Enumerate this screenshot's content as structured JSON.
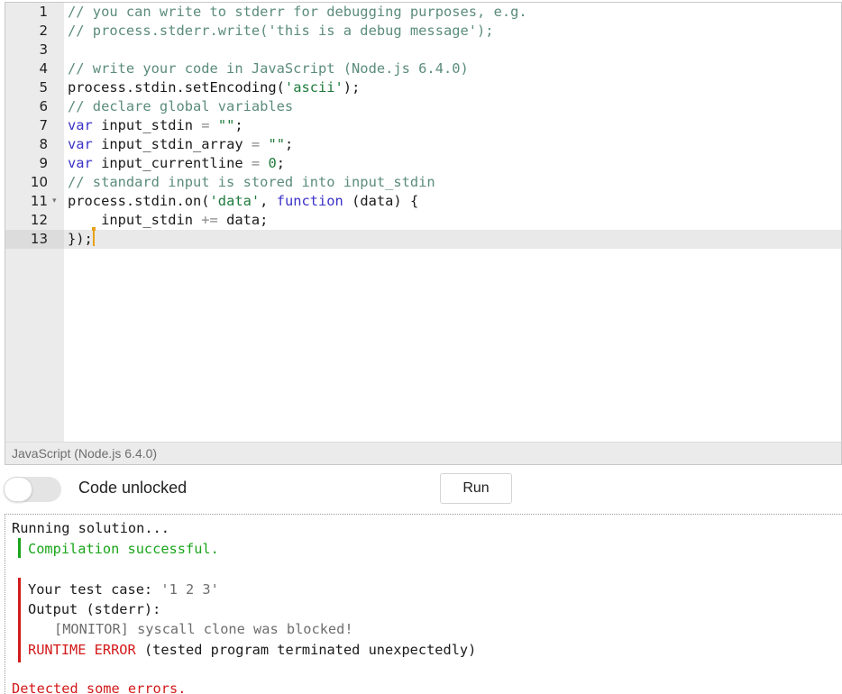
{
  "editor": {
    "language_label": "JavaScript (Node.js 6.4.0)",
    "active_line": 13,
    "lines": [
      {
        "num": "1",
        "fold": "",
        "tokens": [
          {
            "t": "// you can write to stderr for debugging purposes, e.g.",
            "c": "comment"
          }
        ]
      },
      {
        "num": "2",
        "fold": "",
        "tokens": [
          {
            "t": "// process.stderr.write('this is a debug message');",
            "c": "comment"
          }
        ]
      },
      {
        "num": "3",
        "fold": "",
        "tokens": []
      },
      {
        "num": "4",
        "fold": "",
        "tokens": [
          {
            "t": "// write your code in JavaScript (Node.js 6.4.0)",
            "c": "comment"
          }
        ]
      },
      {
        "num": "5",
        "fold": "",
        "tokens": [
          {
            "t": "process.stdin.setEncoding(",
            "c": "plain"
          },
          {
            "t": "'ascii'",
            "c": "string"
          },
          {
            "t": ");",
            "c": "plain"
          }
        ]
      },
      {
        "num": "6",
        "fold": "",
        "tokens": [
          {
            "t": "// declare global variables",
            "c": "comment"
          }
        ]
      },
      {
        "num": "7",
        "fold": "",
        "tokens": [
          {
            "t": "var",
            "c": "keyword"
          },
          {
            "t": " input_stdin ",
            "c": "plain"
          },
          {
            "t": "=",
            "c": "op"
          },
          {
            "t": " ",
            "c": "plain"
          },
          {
            "t": "\"\"",
            "c": "string"
          },
          {
            "t": ";",
            "c": "plain"
          }
        ]
      },
      {
        "num": "8",
        "fold": "",
        "tokens": [
          {
            "t": "var",
            "c": "keyword"
          },
          {
            "t": " input_stdin_array ",
            "c": "plain"
          },
          {
            "t": "=",
            "c": "op"
          },
          {
            "t": " ",
            "c": "plain"
          },
          {
            "t": "\"\"",
            "c": "string"
          },
          {
            "t": ";",
            "c": "plain"
          }
        ]
      },
      {
        "num": "9",
        "fold": "",
        "tokens": [
          {
            "t": "var",
            "c": "keyword"
          },
          {
            "t": " input_currentline ",
            "c": "plain"
          },
          {
            "t": "=",
            "c": "op"
          },
          {
            "t": " ",
            "c": "plain"
          },
          {
            "t": "0",
            "c": "number"
          },
          {
            "t": ";",
            "c": "plain"
          }
        ]
      },
      {
        "num": "10",
        "fold": "",
        "tokens": [
          {
            "t": "// standard input is stored into input_stdin",
            "c": "comment"
          }
        ]
      },
      {
        "num": "11",
        "fold": "▾",
        "tokens": [
          {
            "t": "process.stdin.on(",
            "c": "plain"
          },
          {
            "t": "'data'",
            "c": "string"
          },
          {
            "t": ", ",
            "c": "plain"
          },
          {
            "t": "function",
            "c": "keyword"
          },
          {
            "t": " (data) {",
            "c": "plain"
          }
        ]
      },
      {
        "num": "12",
        "fold": "",
        "tokens": [
          {
            "t": "    input_stdin ",
            "c": "plain"
          },
          {
            "t": "+=",
            "c": "op"
          },
          {
            "t": " data;",
            "c": "plain"
          }
        ]
      },
      {
        "num": "13",
        "fold": "",
        "tokens": [
          {
            "t": "});",
            "c": "plain"
          }
        ]
      }
    ]
  },
  "controls": {
    "toggle_label": "Code unlocked",
    "toggle_on": false,
    "run_label": "Run"
  },
  "console": {
    "running": "Running solution...",
    "compiled": "Compilation successful.",
    "test_case_label": "Your test case: ",
    "test_case_value": "'1 2 3'",
    "output_label": "Output (stderr):",
    "monitor": "[MONITOR] syscall clone was blocked!",
    "runtime_error": "RUNTIME ERROR",
    "runtime_detail": " (tested program terminated unexpectedly)",
    "detected": "Detected some errors."
  },
  "colors": {
    "comment": "#5b8c7a",
    "keyword": "#3a32c6",
    "string": "#1f7a3c",
    "success": "#1aa51a",
    "error": "#d21a1a",
    "cursor": "#e8a21a"
  }
}
